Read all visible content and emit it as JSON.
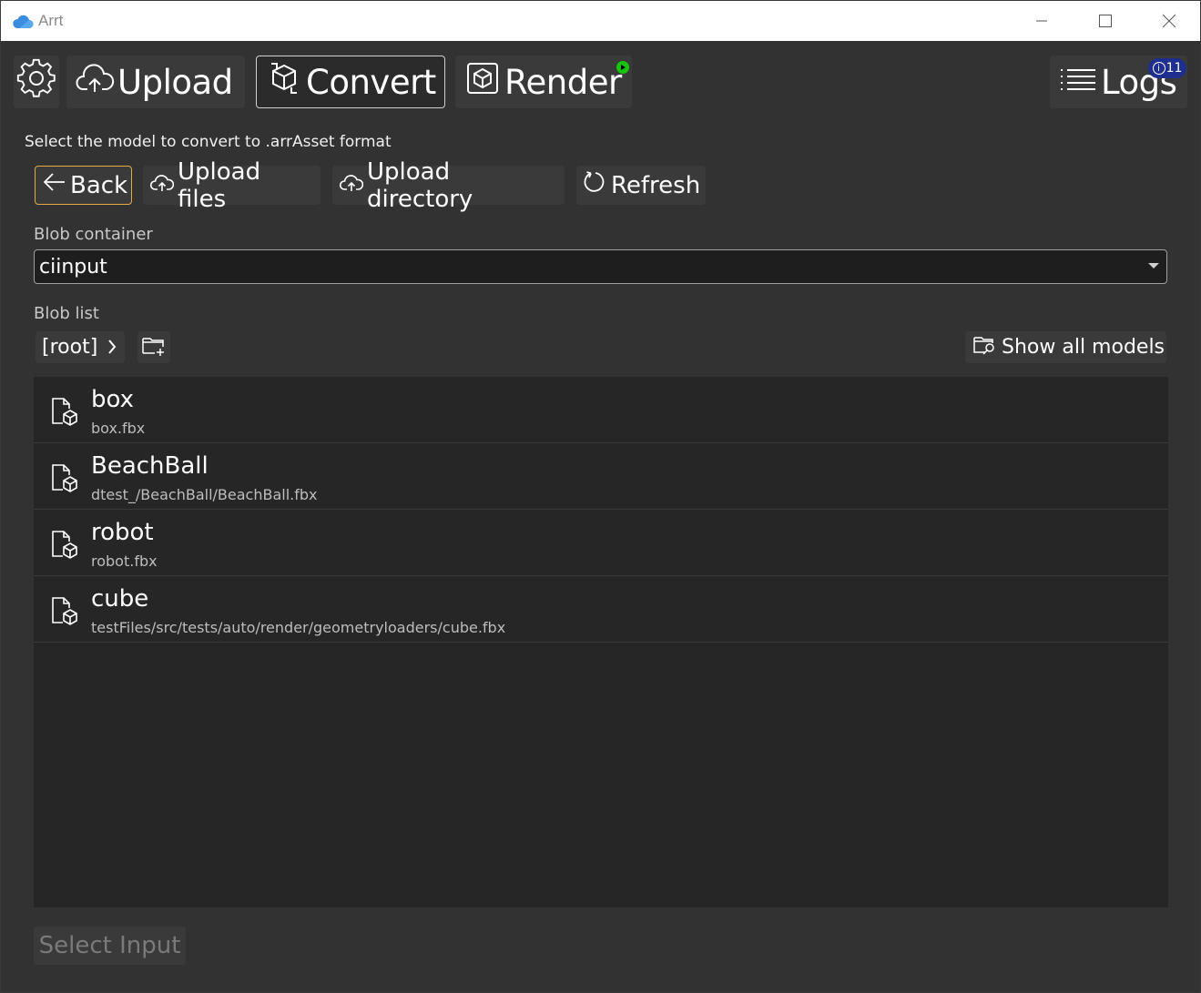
{
  "window": {
    "title": "Arrt"
  },
  "nav": {
    "upload_label": "Upload",
    "convert_label": "Convert",
    "render_label": "Render",
    "logs_label": "Logs",
    "logs_count": "11"
  },
  "page": {
    "subtitle": "Select the model to convert to .arrAsset format"
  },
  "toolbar": {
    "back_label": "Back",
    "upload_files_label": "Upload files",
    "upload_directory_label": "Upload directory",
    "refresh_label": "Refresh"
  },
  "blob_container": {
    "label": "Blob container",
    "value": "ciinput"
  },
  "blob_list": {
    "label": "Blob list",
    "breadcrumb": "[root]",
    "show_all_label": "Show all models",
    "items": [
      {
        "name": "box",
        "path": "box.fbx"
      },
      {
        "name": "BeachBall",
        "path": "dtest_/BeachBall/BeachBall.fbx"
      },
      {
        "name": "robot",
        "path": "robot.fbx"
      },
      {
        "name": "cube",
        "path": "testFiles/src/tests/auto/render/geometryloaders/cube.fbx"
      }
    ]
  },
  "footer": {
    "select_input_label": "Select Input"
  },
  "colors": {
    "accent_back_border": "#e6a946",
    "render_status": "#16c60c",
    "logs_badge": "#1e2f8f"
  }
}
